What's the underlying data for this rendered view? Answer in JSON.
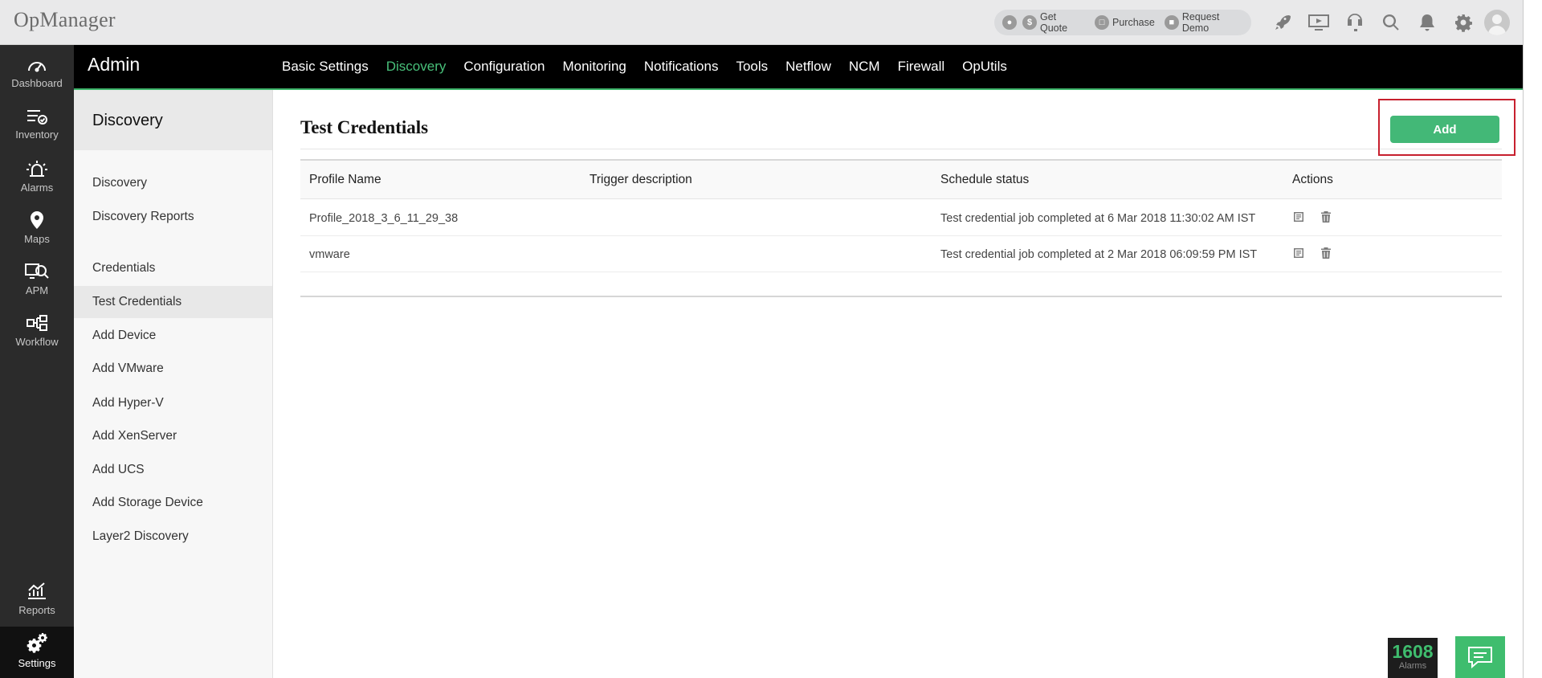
{
  "app": {
    "logo": "OpManager"
  },
  "quote_bar": {
    "items": [
      {
        "icon": "headset-icon",
        "label": ""
      },
      {
        "icon": "dollar-icon",
        "label": "Get Quote"
      },
      {
        "icon": "cart-icon",
        "label": "Purchase"
      },
      {
        "icon": "demo-icon",
        "label": "Request Demo"
      }
    ]
  },
  "top_icons": [
    "rocket-icon",
    "video-icon",
    "support-icon",
    "search-icon",
    "bell-icon",
    "gear-icon",
    "user-avatar-icon"
  ],
  "rail": {
    "items": [
      {
        "label": "Dashboard",
        "icon": "speedometer-icon"
      },
      {
        "label": "Inventory",
        "icon": "inventory-check-icon"
      },
      {
        "label": "Alarms",
        "icon": "alarm-light-icon"
      },
      {
        "label": "Maps",
        "icon": "map-pin-icon"
      },
      {
        "label": "APM",
        "icon": "apm-monitor-icon"
      },
      {
        "label": "Workflow",
        "icon": "workflow-icon"
      },
      {
        "label": "Reports",
        "icon": "reports-chart-icon"
      },
      {
        "label": "Settings",
        "icon": "settings-gears-icon"
      }
    ],
    "active": "Settings"
  },
  "admin": {
    "title": "Admin",
    "nav": [
      "Basic Settings",
      "Discovery",
      "Configuration",
      "Monitoring",
      "Notifications",
      "Tools",
      "Netflow",
      "NCM",
      "Firewall",
      "OpUtils"
    ],
    "active": "Discovery"
  },
  "sidebar": {
    "title": "Discovery",
    "items": [
      "Discovery",
      "Discovery Reports",
      "Credentials",
      "Test Credentials",
      "Add Device",
      "Add VMware",
      "Add Hyper-V",
      "Add XenServer",
      "Add UCS",
      "Add Storage Device",
      "Layer2 Discovery"
    ],
    "active": "Test Credentials"
  },
  "main": {
    "title": "Test Credentials",
    "add_label": "Add",
    "columns": [
      "Profile Name",
      "Trigger description",
      "Schedule status",
      "Actions"
    ],
    "rows": [
      {
        "profile": "Profile_2018_3_6_11_29_38",
        "trigger": "",
        "status": "Test credential job completed at 6 Mar 2018 11:30:02 AM IST"
      },
      {
        "profile": "vmware",
        "trigger": "",
        "status": "Test credential job completed at 2 Mar 2018 06:09:59 PM IST"
      }
    ]
  },
  "bottom": {
    "alarm_count": "1608",
    "alarm_label": "Alarms"
  },
  "colors": {
    "accent_green": "#43b877",
    "highlight_red": "#c7202e",
    "rail_bg": "#2b2b2b",
    "admin_bg": "#000000"
  }
}
